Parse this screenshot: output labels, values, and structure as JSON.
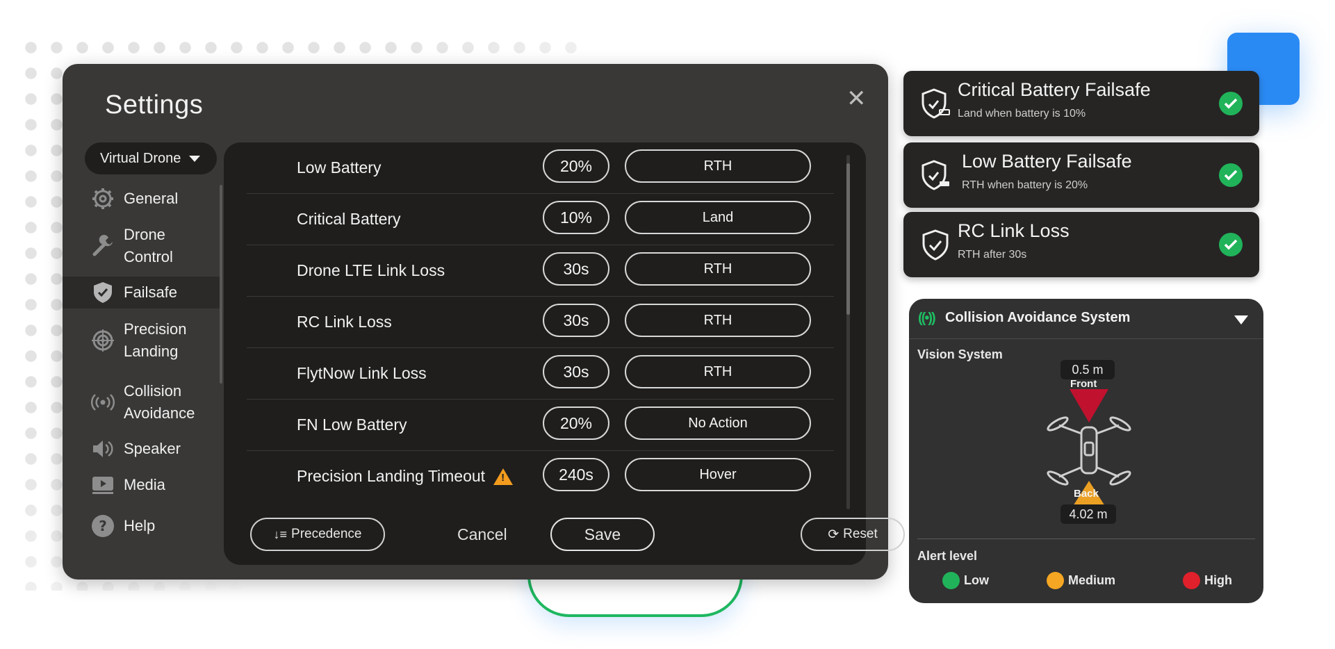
{
  "settings": {
    "title": "Settings",
    "close_icon": "close-icon",
    "drone_select": "Virtual Drone",
    "sidebar": [
      {
        "label": "General",
        "icon": "gear-icon"
      },
      {
        "label": "Drone Control",
        "icon": "wrench-icon"
      },
      {
        "label": "Failsafe",
        "icon": "shield-icon"
      },
      {
        "label": "Precision Landing",
        "icon": "target-icon"
      },
      {
        "label": "Collision Avoidance",
        "icon": "radio-waves-icon"
      },
      {
        "label": "Speaker",
        "icon": "speaker-icon"
      },
      {
        "label": "Media",
        "icon": "play-icon"
      },
      {
        "label": "Help",
        "icon": "help-icon"
      }
    ],
    "rows": [
      {
        "label": "Low Battery",
        "value": "20%",
        "action": "RTH"
      },
      {
        "label": "Critical Battery",
        "value": "10%",
        "action": "Land"
      },
      {
        "label": "Drone LTE Link Loss",
        "value": "30s",
        "action": "RTH"
      },
      {
        "label": "RC Link Loss",
        "value": "30s",
        "action": "RTH"
      },
      {
        "label": "FlytNow Link Loss",
        "value": "30s",
        "action": "RTH"
      },
      {
        "label": "FN Low Battery",
        "value": "20%",
        "action": "No Action"
      },
      {
        "label": "Precision Landing Timeout",
        "value": "240s",
        "action": "Hover"
      }
    ],
    "footer": {
      "precedence": "Precedence",
      "cancel": "Cancel",
      "save": "Save",
      "reset": "Reset"
    }
  },
  "failsafe_cards": [
    {
      "title": "Critical Battery Failsafe",
      "subtitle": "Land when battery is 10%"
    },
    {
      "title": "Low Battery Failsafe",
      "subtitle": "RTH when battery is 20%"
    },
    {
      "title": "RC Link Loss",
      "subtitle": "RTH after 30s"
    }
  ],
  "collision": {
    "title": "Collision Avoidance System",
    "vision_label": "Vision System",
    "front_distance": "0.5 m",
    "front_label": "Front",
    "back_label": "Back",
    "back_distance": "4.02 m",
    "alert_label": "Alert level",
    "levels": [
      {
        "label": "Low",
        "color": "#21b35a"
      },
      {
        "label": "Medium",
        "color": "#f5a623"
      },
      {
        "label": "High",
        "color": "#e0202b"
      }
    ]
  },
  "colors": {
    "accent_blue": "#2a8af4",
    "success_green": "#21b35a",
    "warning_orange": "#f39b1e",
    "front_zone": "#c8102e",
    "back_zone": "#f5a623"
  }
}
